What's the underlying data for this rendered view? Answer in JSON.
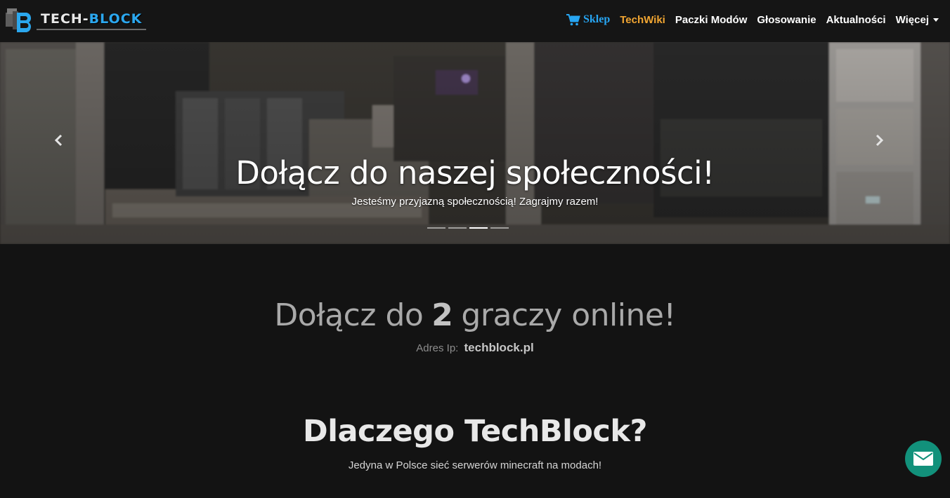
{
  "brand": {
    "name_part1": "TECH-",
    "name_part2": "BLOCK",
    "accent": "#2ba7ee"
  },
  "nav": {
    "shop": "Sklep",
    "wiki": "TechWiki",
    "modpacks": "Paczki Modów",
    "vote": "Głosowanie",
    "news": "Aktualności",
    "more": "Więcej"
  },
  "hero": {
    "title": "Dołącz do naszej społeczności!",
    "subtitle": "Jesteśmy przyjazną społecznością! Zagrajmy razem!",
    "slide_count": 4,
    "active_slide": 3
  },
  "online": {
    "prefix": "Dołącz do",
    "count": "2",
    "suffix": "graczy online!",
    "ip_label": "Adres Ip:",
    "ip": "techblock.pl"
  },
  "why": {
    "title": "Dlaczego TechBlock?",
    "subtitle": "Jedyna w Polsce sieć serwerów minecraft na modach!"
  },
  "colors": {
    "shop": "#27a5f2",
    "wiki": "#f2a632",
    "mail_button": "#12917b"
  },
  "icons": {
    "shop": "cart-icon",
    "prev": "chevron-left-icon",
    "next": "chevron-right-icon",
    "contact": "envelope-icon"
  }
}
